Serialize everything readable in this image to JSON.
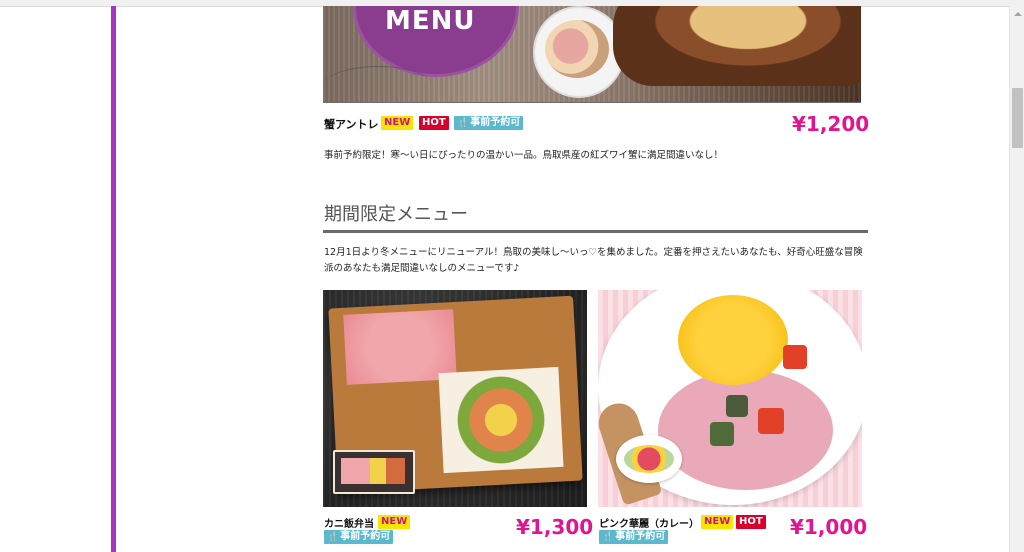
{
  "hero": {
    "menu_text": "MENU"
  },
  "item1": {
    "name": "蟹アントレ",
    "badge_new": "NEW",
    "badge_hot": "HOT",
    "badge_reservation": "事前予約可",
    "price": "¥1,200",
    "description": "事前予約限定！寒〜い日にぴったりの温かい一品。鳥取県産の紅ズワイ蟹に満足間違いなし！"
  },
  "section": {
    "title": "期間限定メニュー",
    "description": "12月1日より冬メニューにリニューアル！鳥取の美味し〜いっ♡を集めました。定番を押さえたいあなたも、好奇心旺盛な冒険派のあなたも満足間違いなしのメニューです♪"
  },
  "item2": {
    "name": "カニ飯弁当",
    "badge_new": "NEW",
    "badge_reservation": "事前予約可",
    "price": "¥1,300"
  },
  "item3": {
    "name": "ピンク華麗（カレー）",
    "badge_new": "NEW",
    "badge_hot": "HOT",
    "badge_reservation": "事前予約可",
    "price": "¥1,000"
  },
  "icons": {
    "reservation": "fork-knife-icon"
  },
  "colors": {
    "accent_bar": "#a535c2",
    "price": "#e0168f",
    "new_bg": "#f7e400",
    "hot_bg": "#d8002b",
    "reservation_bg": "#5ab9cc"
  }
}
